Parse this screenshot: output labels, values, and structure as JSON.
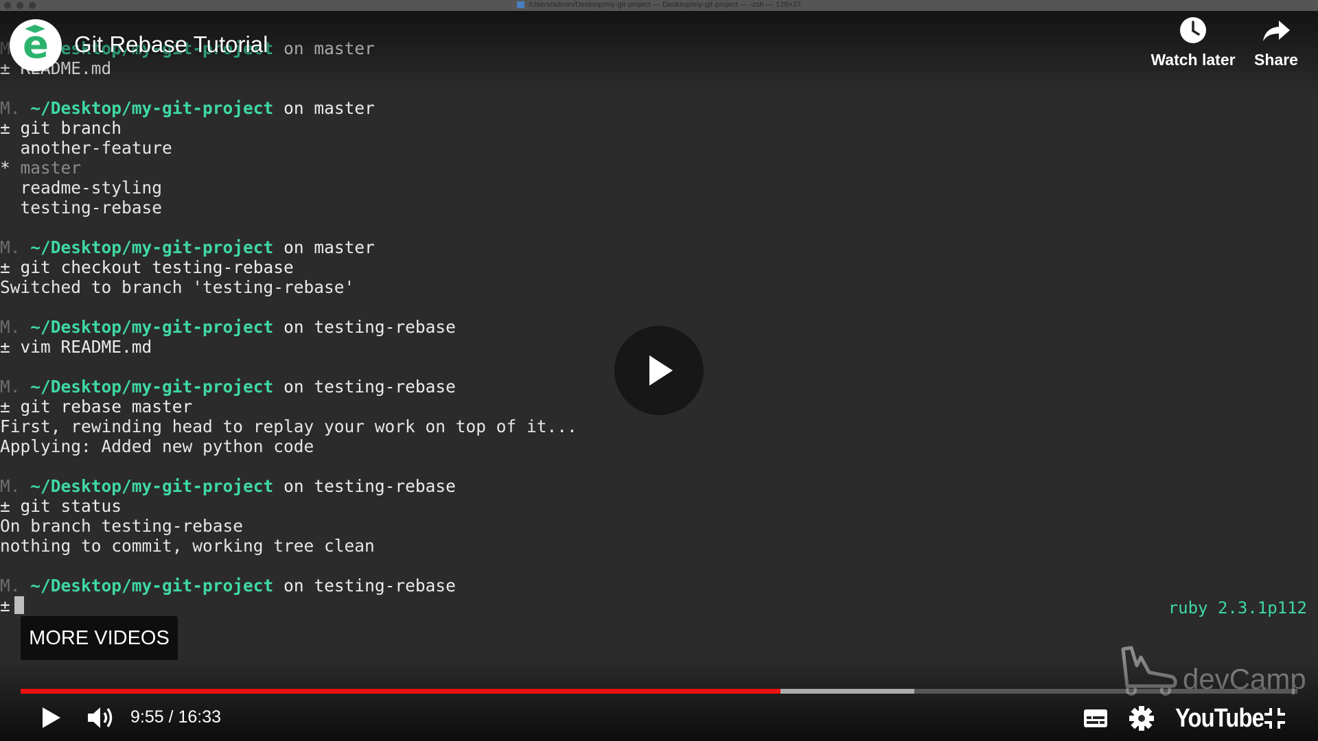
{
  "window": {
    "title": "/Users/admin/Desktop/my-git-project — Desktop/my-git-project — -zsh — 128×37"
  },
  "video": {
    "title": "Git Rebase Tutorial",
    "logo_letter": "e",
    "watch_later_label": "Watch later",
    "share_label": "Share",
    "more_videos_label": "MORE VIDEOS",
    "watermark_text": "devCamp",
    "youtube_label": "YouTube",
    "time_display": "9:55 / 16:33",
    "progress": {
      "played_fraction": 0.595,
      "buffered_fraction": 0.7
    }
  },
  "terminal": {
    "right_prompt": "ruby 2.3.1p112",
    "lines": [
      {
        "type": "prompt",
        "mark": "M.",
        "path": "~/Desktop/my-git-project",
        "branch": "on master"
      },
      {
        "type": "cmd",
        "text": "README.md"
      },
      {
        "type": "blank"
      },
      {
        "type": "prompt",
        "mark": "M.",
        "path": "~/Desktop/my-git-project",
        "branch": "on master"
      },
      {
        "type": "cmd",
        "text": "git branch"
      },
      {
        "type": "out",
        "text": "  another-feature"
      },
      {
        "type": "current",
        "text": "master"
      },
      {
        "type": "out",
        "text": "  readme-styling"
      },
      {
        "type": "out",
        "text": "  testing-rebase"
      },
      {
        "type": "blank"
      },
      {
        "type": "prompt",
        "mark": "M.",
        "path": "~/Desktop/my-git-project",
        "branch": "on master"
      },
      {
        "type": "cmd",
        "text": "git checkout testing-rebase"
      },
      {
        "type": "out",
        "text": "Switched to branch 'testing-rebase'"
      },
      {
        "type": "blank"
      },
      {
        "type": "prompt",
        "mark": "M.",
        "path": "~/Desktop/my-git-project",
        "branch": "on testing-rebase"
      },
      {
        "type": "cmd",
        "text": "vim README.md"
      },
      {
        "type": "blank"
      },
      {
        "type": "prompt",
        "mark": "M.",
        "path": "~/Desktop/my-git-project",
        "branch": "on testing-rebase"
      },
      {
        "type": "cmd",
        "text": "git rebase master"
      },
      {
        "type": "out",
        "text": "First, rewinding head to replay your work on top of it..."
      },
      {
        "type": "out",
        "text": "Applying: Added new python code"
      },
      {
        "type": "blank"
      },
      {
        "type": "prompt",
        "mark": "M.",
        "path": "~/Desktop/my-git-project",
        "branch": "on testing-rebase"
      },
      {
        "type": "cmd",
        "text": "git status"
      },
      {
        "type": "out",
        "text": "On branch testing-rebase"
      },
      {
        "type": "out",
        "text": "nothing to commit, working tree clean"
      },
      {
        "type": "blank"
      },
      {
        "type": "prompt",
        "mark": "M.",
        "path": "~/Desktop/my-git-project",
        "branch": "on testing-rebase"
      },
      {
        "type": "input",
        "text": ""
      }
    ]
  },
  "colors": {
    "path_green": "#3fd9a2",
    "progress_red": "#ee1111",
    "logo_green": "#2bb36d"
  }
}
